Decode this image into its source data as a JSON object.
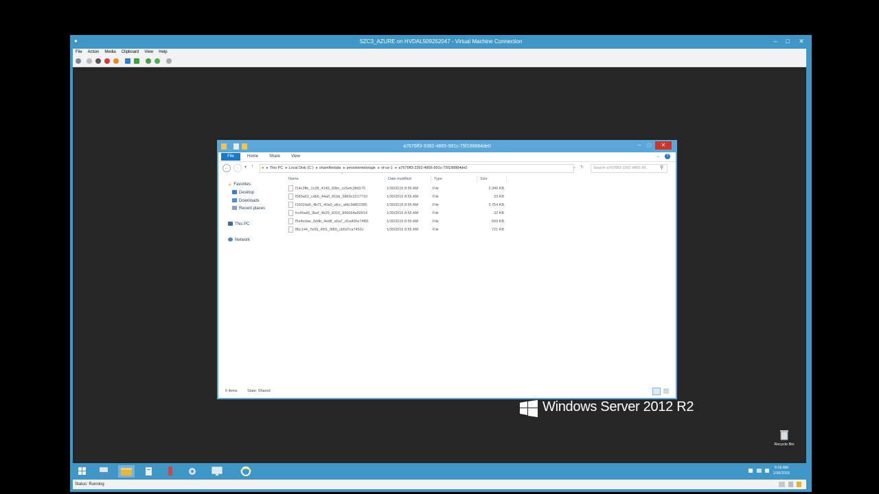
{
  "vm": {
    "title": "SZC3_AZURE on HVDAL509252047 - Virtual Machine Connection",
    "menu": [
      "File",
      "Action",
      "Media",
      "Clipboard",
      "View",
      "Help"
    ],
    "status": "Status: Running"
  },
  "explorer": {
    "title": "a7676ff3-3392-4865-991c-75f198884de0",
    "ribbon_tabs": [
      "File",
      "Home",
      "Share",
      "View"
    ],
    "address": [
      "This PC",
      "Local Disk (C:)",
      "sharefiledata",
      "persistentstorage",
      "sf-us-1",
      "a7676ff3-3392-4865-991c-75f198884de0"
    ],
    "search_placeholder": "Search a7676ff3-3392-4865-99...",
    "nav": {
      "favorites": "Favorites",
      "desktop": "Desktop",
      "downloads": "Downloads",
      "recent": "Recent places",
      "thispc": "This PC",
      "network": "Network"
    },
    "columns": [
      "Name",
      "Date modified",
      "Type",
      "Size"
    ],
    "files": [
      {
        "name": "f14c3ffe_1c28_4145_90bc_cc5efc38d175",
        "date": "1/30/2015 8:55 AM",
        "type": "File",
        "size": "2,346 KB"
      },
      {
        "name": "f083a62_cdb5_44a0_81bb_5869c3217710",
        "date": "1/30/2015 8:55 AM",
        "type": "File",
        "size": "33 KB"
      },
      {
        "name": "f1602da6_4b71_40a9_afcc_afdc3d802385",
        "date": "1/30/2015 8:55 AM",
        "type": "File",
        "size": "3,754 KB"
      },
      {
        "name": "fccf0ad9_3bef_4b29_8310_846664a69914",
        "date": "1/30/2015 8:55 AM",
        "type": "File",
        "size": "32 KB"
      },
      {
        "name": "f5e4edae_6d4b_4ed8_a0a7_d1a400e74f81",
        "date": "1/30/2015 8:55 AM",
        "type": "File",
        "size": "560 KB"
      },
      {
        "name": "ffbc144_7e59_45f1_9f80_cb5d7ca7452c",
        "date": "1/30/2015 8:55 AM",
        "type": "File",
        "size": "721 KB"
      }
    ],
    "status_items": "6 items",
    "status_state": "State: Shared"
  },
  "watermark": "Windows Server 2012 R2",
  "recycle_label": "Recycle Bin",
  "clock": {
    "time": "9:16 AM",
    "date": "1/30/2015"
  }
}
